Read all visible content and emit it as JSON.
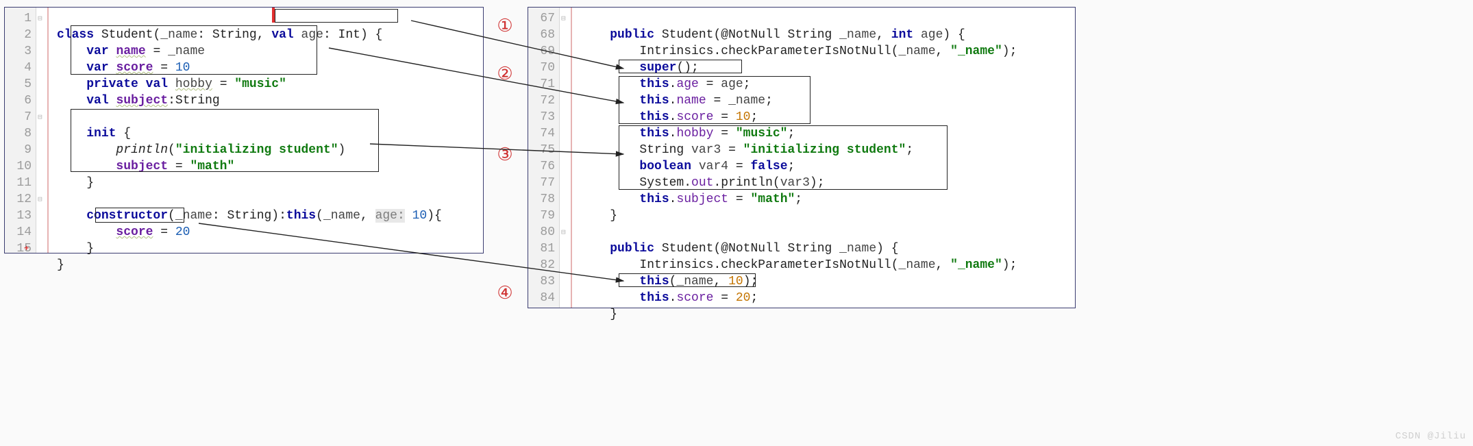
{
  "left_gutter": [
    "1",
    "2",
    "3",
    "4",
    "5",
    "6",
    "7",
    "8",
    "9",
    "10",
    "11",
    "12",
    "13",
    "14",
    "15"
  ],
  "right_gutter": [
    "67",
    "68",
    "69",
    "70",
    "71",
    "72",
    "73",
    "74",
    "75",
    "76",
    "77",
    "78",
    "79",
    "80",
    "81",
    "82",
    "83",
    "84"
  ],
  "kw": {
    "class": "class",
    "val": "val",
    "var": "var",
    "private": "private",
    "init": "init",
    "constructor": "constructor",
    "this": "this",
    "public": "public",
    "int": "int",
    "super": "super",
    "boolean": "boolean",
    "false": "false"
  },
  "id": {
    "Student": "Student",
    "_name": "_name",
    "String": "String",
    "age": "age",
    "Int": "Int",
    "name": "name",
    "score": "score",
    "hobby": "hobby",
    "subject": "subject",
    "println": "println",
    "NotNull": "@NotNull",
    "Intrinsics": "Intrinsics",
    "checkParameterIsNotNull": "checkParameterIsNotNull",
    "System": "System",
    "out": "out",
    "var3": "var3",
    "var4": "var4"
  },
  "str": {
    "music": "\"music\"",
    "init_stud": "\"initializing student\"",
    "math": "\"math\"",
    "_name_q": "\"_name\""
  },
  "num": {
    "n10": "10",
    "n20": "20"
  },
  "age_hint": "age:",
  "circled": {
    "c1": "①",
    "c2": "②",
    "c3": "③",
    "c4": "④"
  },
  "plus": "+",
  "watermark": "CSDN @Jiliu"
}
